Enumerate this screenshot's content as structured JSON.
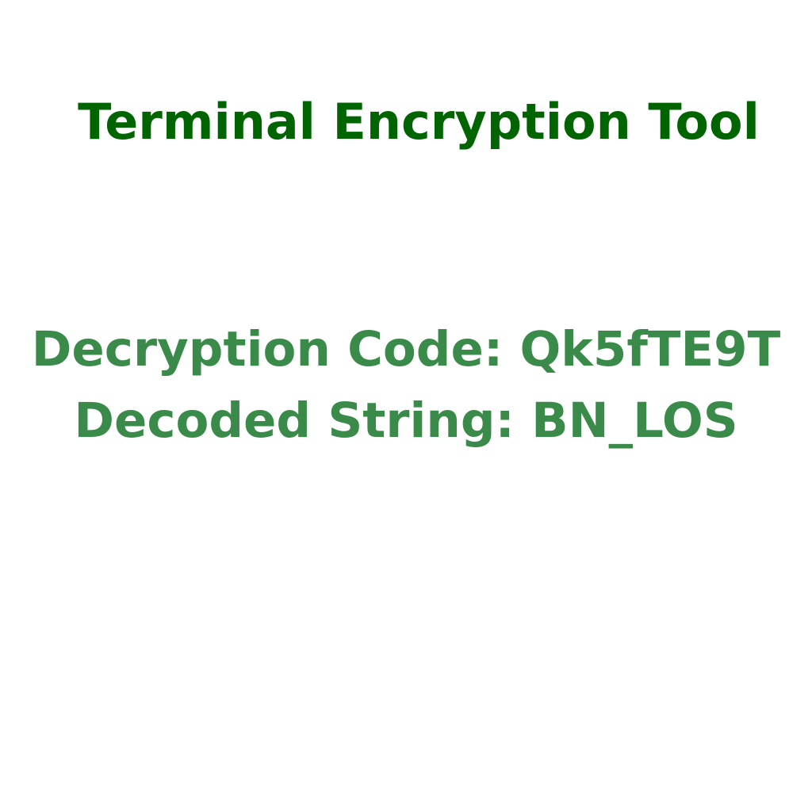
{
  "app": {
    "title": "Terminal Encryption Tool"
  },
  "output": {
    "decryption_code_line": "Decryption Code: Qk5fTE9T",
    "decoded_string_line": "Decoded String: BN_LOS"
  },
  "colors": {
    "title": "#006400",
    "output_text": "#3a8a4a",
    "background": "#ffffff"
  }
}
